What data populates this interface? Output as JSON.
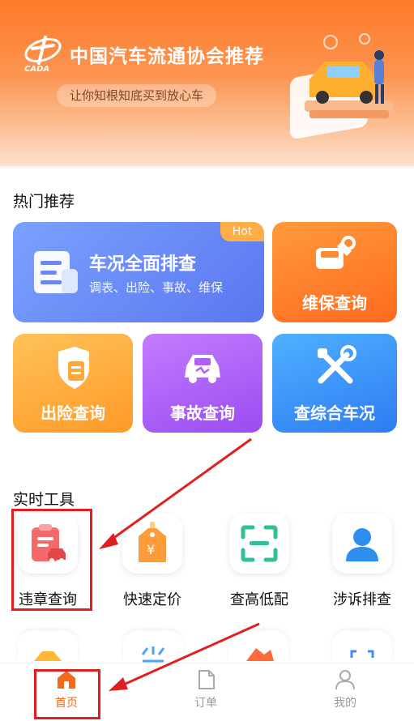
{
  "banner": {
    "title": "中国汽车流通协会推荐",
    "subtitle": "让你知根知底买到放心车",
    "logo_text": "CADA"
  },
  "hot": {
    "title": "热门推荐",
    "main_card": {
      "label": "车况全面排查",
      "desc": "调表、出险、事故、维保",
      "badge": "Hot"
    },
    "cards": [
      {
        "label": "维保查询",
        "icon": "wrench-car-icon"
      },
      {
        "label": "出险查询",
        "icon": "shield-doc-icon"
      },
      {
        "label": "事故查询",
        "icon": "crashed-car-icon"
      },
      {
        "label": "查综合车况",
        "icon": "tools-icon"
      }
    ]
  },
  "tools": {
    "title": "实时工具",
    "items": [
      {
        "label": "违章查询",
        "icon": "violation-clipboard-icon"
      },
      {
        "label": "快速定价",
        "icon": "price-tag-icon"
      },
      {
        "label": "查高低配",
        "icon": "scan-frame-icon"
      },
      {
        "label": "涉诉排查",
        "icon": "person-icon"
      }
    ]
  },
  "tabbar": {
    "items": [
      {
        "label": "首页",
        "active": true
      },
      {
        "label": "订单",
        "active": false
      },
      {
        "label": "我的",
        "active": false
      }
    ]
  },
  "colors": {
    "accent": "#f26a1b",
    "annotation": "#e02020"
  }
}
